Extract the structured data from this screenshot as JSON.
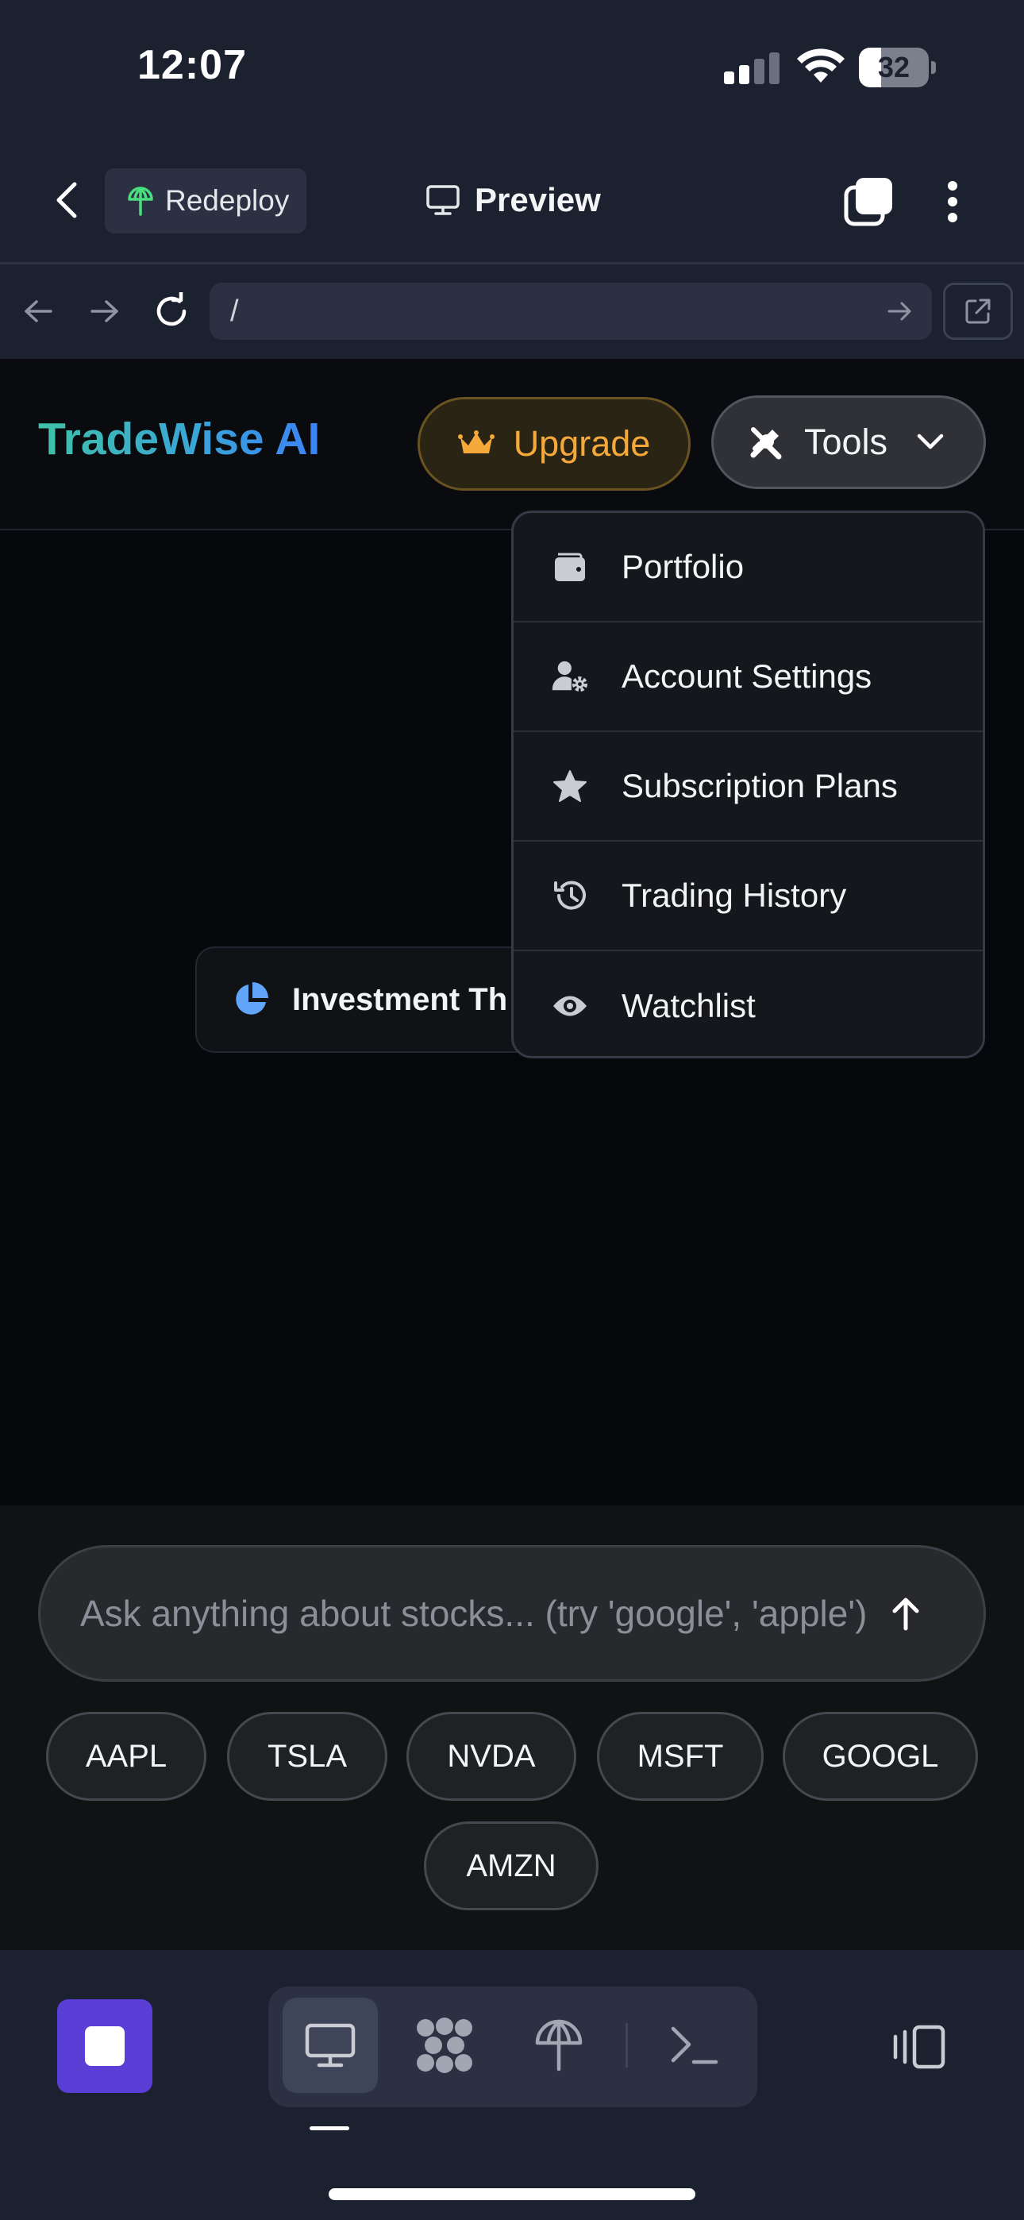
{
  "status_bar": {
    "time": "12:07",
    "battery_percent": "32",
    "battery_level": 0.32
  },
  "ide_header": {
    "redeploy_label": "Redeploy",
    "preview_label": "Preview"
  },
  "browser_bar": {
    "url": "/"
  },
  "app": {
    "brand": "TradeWise AI",
    "upgrade_label": "Upgrade",
    "tools_label": "Tools",
    "investment_chip_label": "Investment Th",
    "tools_menu": [
      {
        "label": "Portfolio",
        "icon": "wallet-icon"
      },
      {
        "label": "Account Settings",
        "icon": "user-gear-icon"
      },
      {
        "label": "Subscription Plans",
        "icon": "star-icon"
      },
      {
        "label": "Trading History",
        "icon": "history-icon"
      },
      {
        "label": "Watchlist",
        "icon": "eye-icon"
      }
    ],
    "chat_placeholder": "Ask anything about stocks... (try 'google', 'apple')",
    "tickers": [
      "AAPL",
      "TSLA",
      "NVDA",
      "MSFT",
      "GOOGL",
      "AMZN"
    ]
  },
  "colors": {
    "brand_gradient_start": "#3fc1a7",
    "brand_gradient_end": "#3b82f6",
    "upgrade_accent": "#f5a93b",
    "stop_button": "#5a3ed6",
    "chrome_background": "#1c2130"
  }
}
